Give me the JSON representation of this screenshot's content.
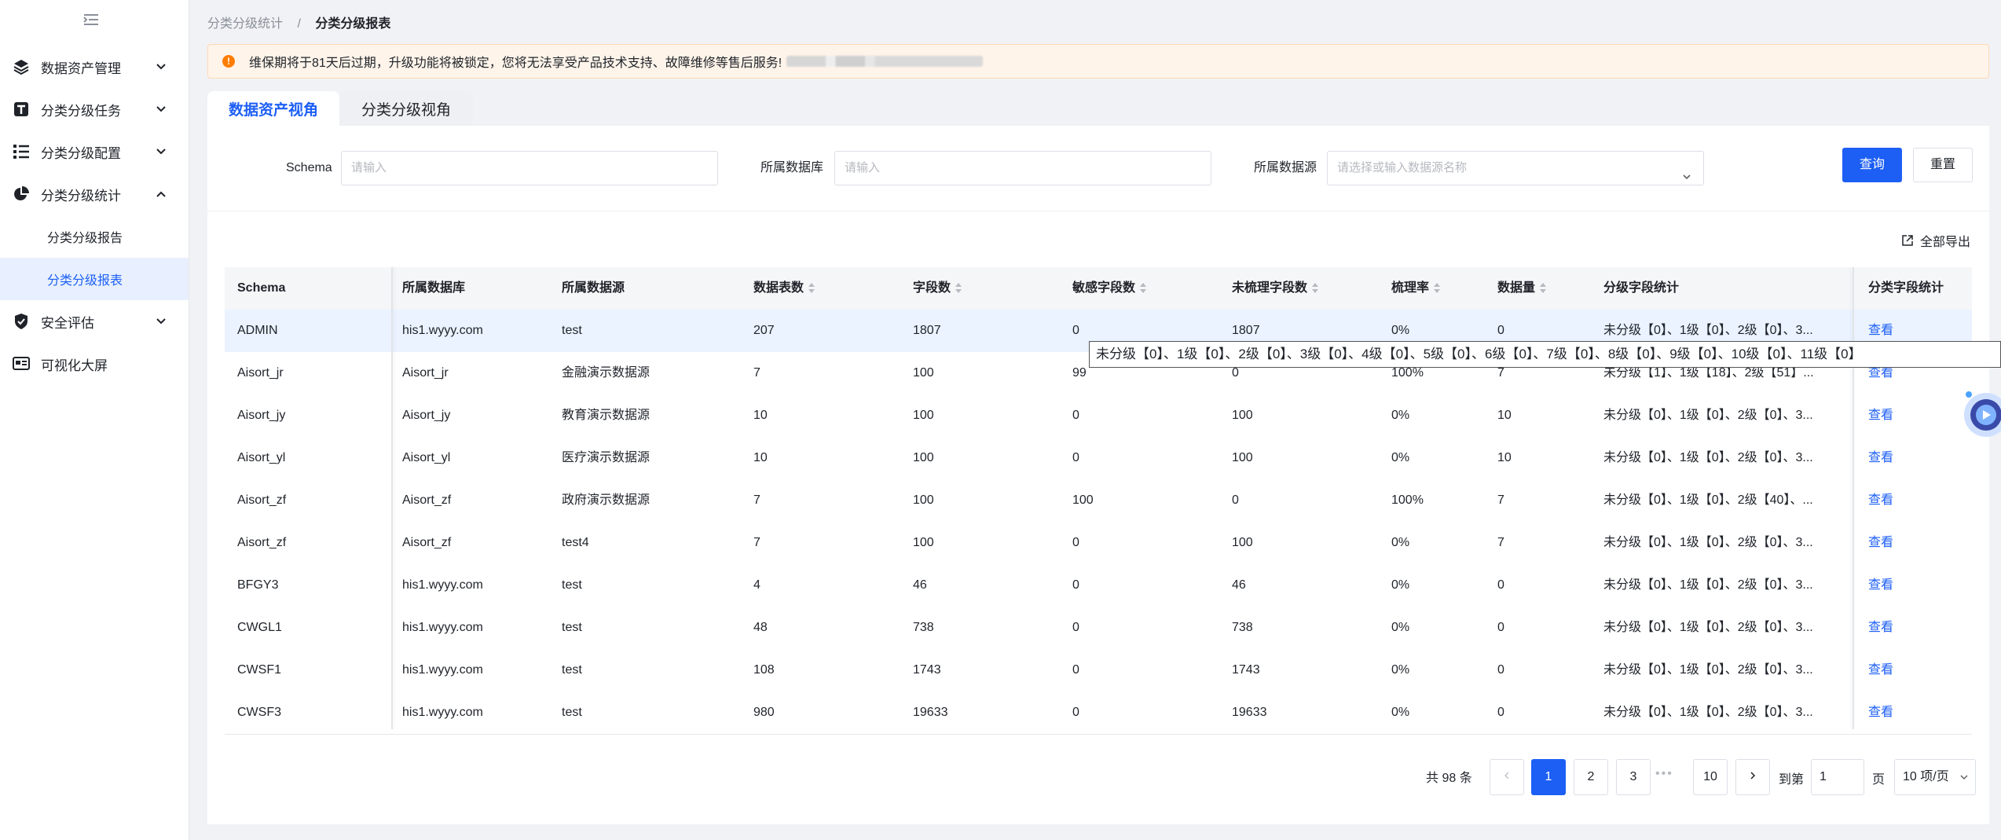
{
  "sidebar": {
    "items": [
      {
        "label": "数据资产管理",
        "icon": "layers-icon"
      },
      {
        "label": "分类分级任务",
        "icon": "task-icon"
      },
      {
        "label": "分类分级配置",
        "icon": "list-config-icon"
      },
      {
        "label": "分类分级统计",
        "icon": "pie-chart-icon"
      },
      {
        "label": "分类分级报告"
      },
      {
        "label": "分类分级报表"
      },
      {
        "label": "安全评估",
        "icon": "shield-icon"
      },
      {
        "label": "可视化大屏",
        "icon": "screen-icon"
      }
    ]
  },
  "breadcrumb": {
    "parent": "分类分级统计",
    "separator": "/",
    "current": "分类分级报表"
  },
  "alert": {
    "text": "维保期将于81天后过期，升级功能将被锁定，您将无法享受产品技术支持、故障维修等售后服务!"
  },
  "tabs": [
    {
      "label": "数据资产视角"
    },
    {
      "label": "分类分级视角"
    }
  ],
  "filters": {
    "schema_label": "Schema",
    "schema_placeholder": "请输入",
    "db_label": "所属数据库",
    "db_placeholder": "请输入",
    "source_label": "所属数据源",
    "source_placeholder": "请选择或输入数据源名称",
    "query_button": "查询",
    "reset_button": "重置"
  },
  "export_label": "全部导出",
  "table": {
    "headers": [
      "Schema",
      "所属数据库",
      "所属数据源",
      "数据表数",
      "字段数",
      "敏感字段数",
      "未梳理字段数",
      "梳理率",
      "数据量",
      "分级字段统计",
      "分类字段统计"
    ],
    "rows": [
      [
        "ADMIN",
        "his1.wyyy.com",
        "test",
        "207",
        "1807",
        "0",
        "1807",
        "0%",
        "0",
        "未分级【0】、1级【0】、2级【0】、3...",
        "查看"
      ],
      [
        "Aisort_jr",
        "Aisort_jr",
        "金融演示数据源",
        "7",
        "100",
        "99",
        "0",
        "100%",
        "7",
        "未分级【1】、1级【18】、2级【51】...",
        "查看"
      ],
      [
        "Aisort_jy",
        "Aisort_jy",
        "教育演示数据源",
        "10",
        "100",
        "0",
        "100",
        "0%",
        "10",
        "未分级【0】、1级【0】、2级【0】、3...",
        "查看"
      ],
      [
        "Aisort_yl",
        "Aisort_yl",
        "医疗演示数据源",
        "10",
        "100",
        "0",
        "100",
        "0%",
        "10",
        "未分级【0】、1级【0】、2级【0】、3...",
        "查看"
      ],
      [
        "Aisort_zf",
        "Aisort_zf",
        "政府演示数据源",
        "7",
        "100",
        "100",
        "0",
        "100%",
        "7",
        "未分级【0】、1级【0】、2级【40】、...",
        "查看"
      ],
      [
        "Aisort_zf",
        "Aisort_zf",
        "test4",
        "7",
        "100",
        "0",
        "100",
        "0%",
        "7",
        "未分级【0】、1级【0】、2级【0】、3...",
        "查看"
      ],
      [
        "BFGY3",
        "his1.wyyy.com",
        "test",
        "4",
        "46",
        "0",
        "46",
        "0%",
        "0",
        "未分级【0】、1级【0】、2级【0】、3...",
        "查看"
      ],
      [
        "CWGL1",
        "his1.wyyy.com",
        "test",
        "48",
        "738",
        "0",
        "738",
        "0%",
        "0",
        "未分级【0】、1级【0】、2级【0】、3...",
        "查看"
      ],
      [
        "CWSF1",
        "his1.wyyy.com",
        "test",
        "108",
        "1743",
        "0",
        "1743",
        "0%",
        "0",
        "未分级【0】、1级【0】、2级【0】、3...",
        "查看"
      ],
      [
        "CWSF3",
        "his1.wyyy.com",
        "test",
        "980",
        "19633",
        "0",
        "19633",
        "0%",
        "0",
        "未分级【0】、1级【0】、2级【0】、3...",
        "查看"
      ]
    ]
  },
  "tooltip": "未分级【0】、1级【0】、2级【0】、3级【0】、4级【0】、5级【0】、6级【0】、7级【0】、8级【0】、9级【0】、10级【0】、11级【0】",
  "pagination": {
    "total": "共 98 条",
    "pages": [
      "1",
      "2",
      "3",
      "10"
    ],
    "current": "1",
    "goto_label": "到第",
    "goto_value": "1",
    "page_label": "页",
    "page_size": "10 项/页"
  },
  "colors": {
    "primary": "#1d5ff5",
    "alert_icon": "#ff7d00"
  }
}
